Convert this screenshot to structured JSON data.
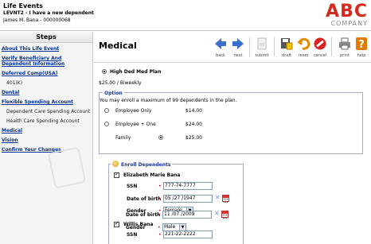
{
  "header": {
    "title": "Life Events",
    "subtitle": "LEVNT2 - I have a new dependent",
    "employee": "James M. Bana - 000000068",
    "logo_text": "ABC",
    "logo_sub": "COMPANY"
  },
  "sidebar": {
    "heading": "Steps",
    "items": [
      {
        "label": "About This Life Event",
        "type": "link"
      },
      {
        "label": "Verify Beneficiary And Dependent Information",
        "type": "link"
      },
      {
        "label": "Deferred Comp(USA)",
        "type": "link"
      },
      {
        "label": "401(K)",
        "type": "sub"
      },
      {
        "label": "Dental",
        "type": "link"
      },
      {
        "label": "Flexible Spending Account",
        "type": "link"
      },
      {
        "label": "Dependent Care Spending Account",
        "type": "sub"
      },
      {
        "label": "Health Care Spending Account",
        "type": "sub"
      },
      {
        "label": "Medical",
        "type": "link"
      },
      {
        "label": "Vision",
        "type": "link"
      },
      {
        "label": "Confirm Your Changes",
        "type": "link"
      }
    ]
  },
  "main": {
    "title": "Medical",
    "toolbar": {
      "back": "back",
      "next": "next",
      "submit": "submit",
      "draft": "draft",
      "reset": "reset",
      "cancel": "cancel",
      "print": "print",
      "help": "help"
    },
    "plan_name": "High Ded Med Plan",
    "plan_cost": "$25.00 / Biweekly",
    "option": {
      "legend": "Option",
      "note": "You may enroll a maximum of 99 dependents in the plan.",
      "rows": [
        {
          "name": "Employee Only",
          "price": "$14.00",
          "selected": false
        },
        {
          "name": "Employee + One",
          "price": "$24.00",
          "selected": false
        },
        {
          "name": "Family",
          "price": "$25.00",
          "selected": true
        }
      ]
    },
    "dependents": {
      "legend": "Enroll Dependents",
      "ssn_label": "SSN",
      "dob_label": "Date of birth",
      "gender_label": "Gender",
      "people": [
        {
          "name": "Elizabeth Marie Bana",
          "ssn": "777-74-7777",
          "dob": "05 /27 /1947",
          "gender": "Female",
          "checked": true
        },
        {
          "name": "Willis Bana",
          "ssn": "221-22-2222",
          "dob": "11 /07 /2009",
          "gender": "Male",
          "checked": true
        }
      ]
    }
  },
  "colors": {
    "link": "#003399",
    "legend": "#1a3399",
    "logo": "#d52b1e",
    "required": "#dd0000"
  }
}
